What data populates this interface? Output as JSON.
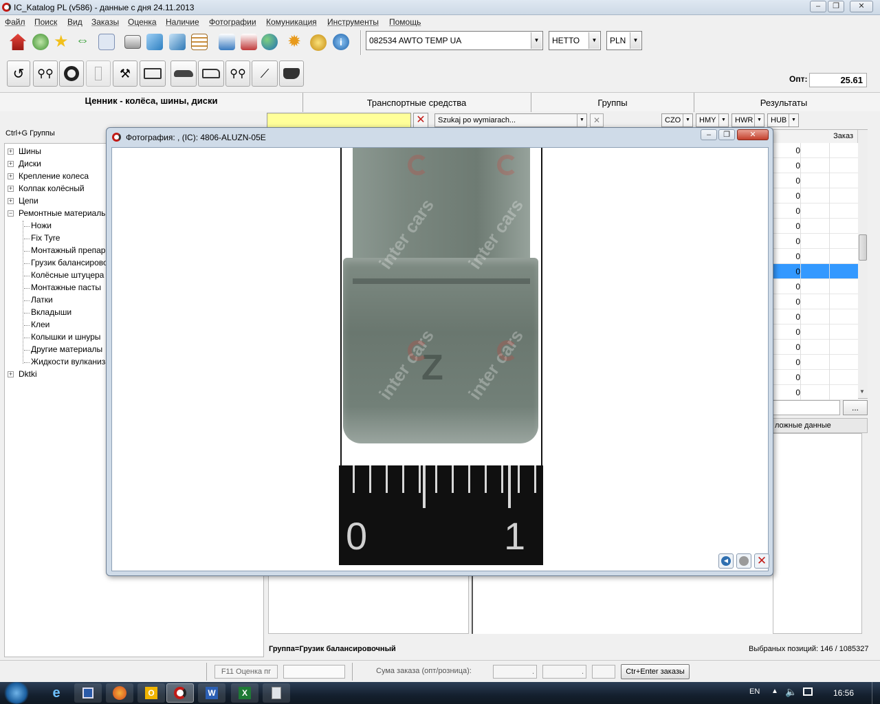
{
  "window": {
    "title": "IC_Katalog PL (v586) - данные с дня 24.11.2013",
    "controls": [
      "–",
      "❐",
      "✕"
    ]
  },
  "menu": [
    "Файл",
    "Поиск",
    "Вид",
    "Заказы",
    "Оценка",
    "Наличие",
    "Фотографии",
    "Комуникация",
    "Инструменты",
    "Помощь"
  ],
  "toolbar": {
    "customer": "082534  AWTO TEMP UA",
    "price_type": "НЕТТО",
    "currency": "PLN",
    "opt_label": "Опт:",
    "opt_value": "25.61",
    "icons": [
      "home-icon",
      "refresh-icon",
      "star-icon",
      "arrows-icon",
      "document-icon",
      "printer-icon",
      "pen-icon",
      "export-icon",
      "list-icon",
      "user-upload-icon",
      "user-download-icon",
      "globe-icon",
      "gear-icon",
      "coins-icon",
      "info-icon"
    ],
    "vehicle_icons": [
      "all-vehicles-icon",
      "motorcycle-icon",
      "tyre-icon",
      "trailer-icon",
      "tools-icon",
      "truck-icon",
      "car-icon",
      "van-icon",
      "quad-icon",
      "tool-icon",
      "tractor-icon"
    ]
  },
  "left_panel": {
    "title": "Ценник - колёса, шины, диски",
    "hint": "Ctrl+G Группы",
    "tree": [
      {
        "label": "Шины",
        "level": 0,
        "expander": "+"
      },
      {
        "label": "Диски",
        "level": 0,
        "expander": "+"
      },
      {
        "label": "Крепление колеса",
        "level": 0,
        "expander": "+"
      },
      {
        "label": "Колпак колёсный",
        "level": 0,
        "expander": "+"
      },
      {
        "label": "Цепи",
        "level": 0,
        "expander": "+"
      },
      {
        "label": "Ремонтные материалы",
        "level": 0,
        "expander": "−"
      },
      {
        "label": "Ножи",
        "level": 1
      },
      {
        "label": "Fix Tyre",
        "level": 1
      },
      {
        "label": "Монтажный препарат",
        "level": 1
      },
      {
        "label": "Грузик балансировочный",
        "level": 1
      },
      {
        "label": "Колёсные штуцера",
        "level": 1
      },
      {
        "label": "Монтажные пасты",
        "level": 1
      },
      {
        "label": "Латки",
        "level": 1
      },
      {
        "label": "Вкладыши",
        "level": 1
      },
      {
        "label": "Клеи",
        "level": 1
      },
      {
        "label": "Колышки и шнуры",
        "level": 1
      },
      {
        "label": "Другие материалы",
        "level": 1
      },
      {
        "label": "Жидкости вулканизационные",
        "level": 1
      },
      {
        "label": "Dktki",
        "level": 0,
        "expander": "+"
      }
    ]
  },
  "tabs": [
    "Транспортные средства",
    "Группы",
    "Результаты"
  ],
  "filters": {
    "search_placeholder": "Szukaj po wymiarach...",
    "czo": "CZO",
    "hmy": "HMY",
    "hwr": "HWR",
    "hub": "HUB"
  },
  "results": {
    "header_order": "Заказ",
    "rows": [
      "0",
      "0",
      "0",
      "0",
      "0",
      "0",
      "0",
      "0",
      "0",
      "0",
      "0",
      "0",
      "0",
      "0",
      "0",
      "0",
      "0"
    ],
    "selected_row": 8,
    "more_button": "...",
    "complex_label": "ложные данные"
  },
  "status": {
    "group_text": "Группа=Грузик балансировочный",
    "selected_text": "Выбраных позиций: 146 / 1085327"
  },
  "bottom": {
    "estimate_button": "F11 Оценка пг",
    "sum_label": "Сума заказа (опт/розница):",
    "sum1": ".",
    "sum2": ".",
    "order_button": "Ctr+Enter заказы"
  },
  "dialog": {
    "title": "Фотография: , (IC): 4806-ALUZN-05E",
    "watermark": "inter cars",
    "ruler": {
      "left": "0",
      "right": "1"
    },
    "controls": [
      "–",
      "❐",
      "✕"
    ]
  },
  "taskbar": {
    "lang": "EN",
    "time": "16:56",
    "apps": [
      "ie-icon",
      "save-icon",
      "firefox-icon",
      "outlook-icon",
      "ic-katalog-icon",
      "word-icon",
      "excel-icon",
      "calculator-icon"
    ]
  },
  "colors": {
    "selected": "#3399ff",
    "filter_yellow": "#ffff99",
    "accent_red": "#c21b17"
  }
}
